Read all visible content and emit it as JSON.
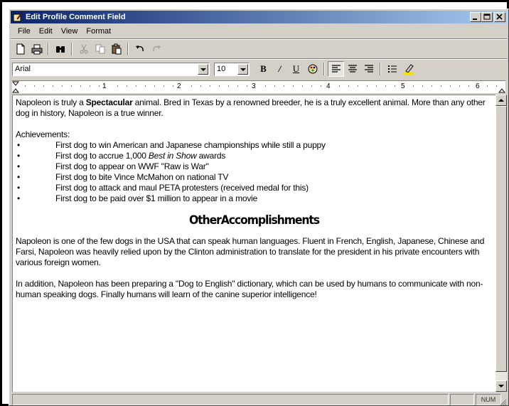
{
  "window": {
    "title": "Edit Profile Comment Field"
  },
  "menu": [
    "File",
    "Edit",
    "View",
    "Format"
  ],
  "format_toolbar": {
    "font_name": "Arial",
    "font_size": "10",
    "bold": "B",
    "italic": "/",
    "underline": "U"
  },
  "ruler": {
    "numbers": [
      "1",
      "2",
      "3",
      "4",
      "5",
      "6"
    ]
  },
  "document": {
    "intro_a": "Napoleon is truly a ",
    "intro_bold": "Spectacular",
    "intro_b": " animal.  Bred in Texas by a renowned breeder, he is a truly excellent animal.  More than any other dog in history, Napoleon is a true winner.",
    "achievements_label": "Achievements:",
    "bullet_symbol": "•",
    "achievements": [
      "First dog to win American and Japanese championships while still a puppy",
      "First dog to accrue 1,000 ",
      "First dog to appear on WWF \"Raw is War\"",
      "First dog to bite Vince McMahon on national TV",
      "First dog to attack and maul PETA protesters (received medal for this)",
      "First dog to be paid over $1 million to appear in a movie"
    ],
    "achievement_2_italic": "Best in Show",
    "achievement_2_tail": " awards",
    "heading": "OtherAccomplishments",
    "para1": "Napoleon is one of the few dogs in the USA that can speak human languages.  Fluent in French, English, Japanese, Chinese and Farsi, Napoleon was heavily relied upon by the Clinton administration to translate for the president in his private encounters with various foreign women.",
    "para2": "In addition, Napoleon has been preparing a \"Dog to English\" dictionary, which can be used by humans to communicate with non-human speaking dogs.  Finally humans will learn of the canine superior intelligence!"
  },
  "status": {
    "num": "NUM"
  }
}
